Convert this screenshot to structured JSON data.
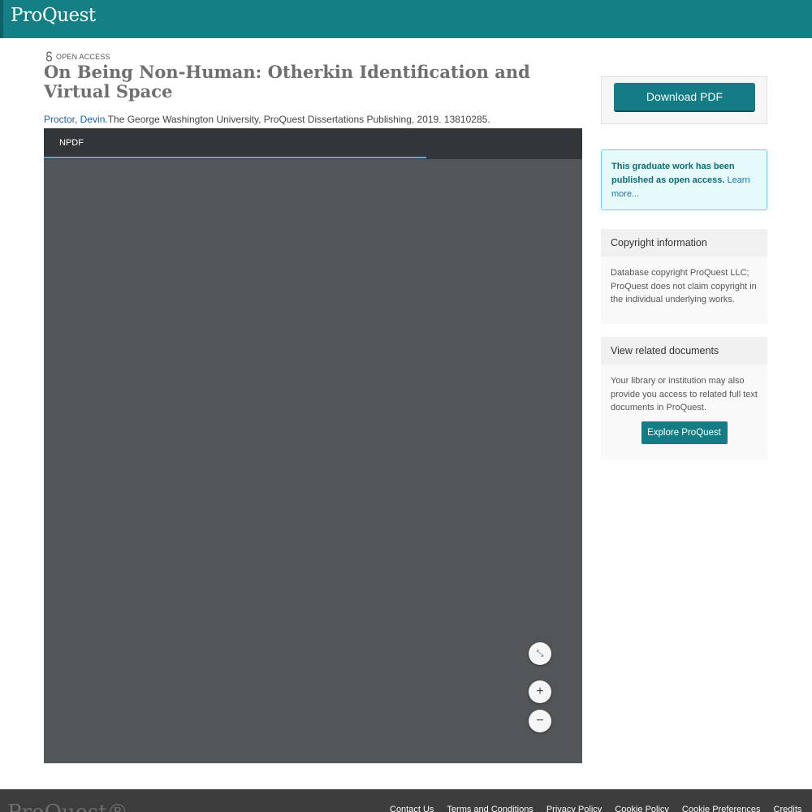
{
  "header": {
    "logo_text": "ProQuest"
  },
  "article": {
    "access_label": "OPEN ACCESS",
    "title": "On Being Non-Human: Otherkin Identification and Virtual Space",
    "author": "Proctor, Devin.",
    "citation": "The George Washington University, ProQuest Dissertations Publishing, 2019. 13810285."
  },
  "viewer": {
    "tab_label": "NPDF",
    "load_progress": 0.71,
    "fit_icon": "⤡",
    "zoom_in": "+",
    "zoom_out": "−"
  },
  "sidebar": {
    "download_label": "Download PDF",
    "oa_notice": "This graduate work has been published as open access.",
    "oa_learn_more": "Learn more...",
    "copyright_heading": "Copyright information",
    "copyright_text": "Database copyright ProQuest LLC; ProQuest does not claim copyright in the individual underlying works.",
    "related_heading": "View related documents",
    "related_text": "Your library or institution may also provide you access to related full text documents in ProQuest.",
    "explore_label": "Explore ProQuest"
  },
  "footer": {
    "logo_text": "ProQuest®",
    "links": [
      "Contact Us",
      "Terms and Conditions",
      "Privacy Policy",
      "Cookie Policy",
      "Cookie Preferences",
      "Credits"
    ]
  },
  "colors": {
    "brand": "#157f86",
    "viewer_bg": "#525659",
    "viewer_bar": "#323639",
    "oa_box_border": "#69d5e2"
  }
}
